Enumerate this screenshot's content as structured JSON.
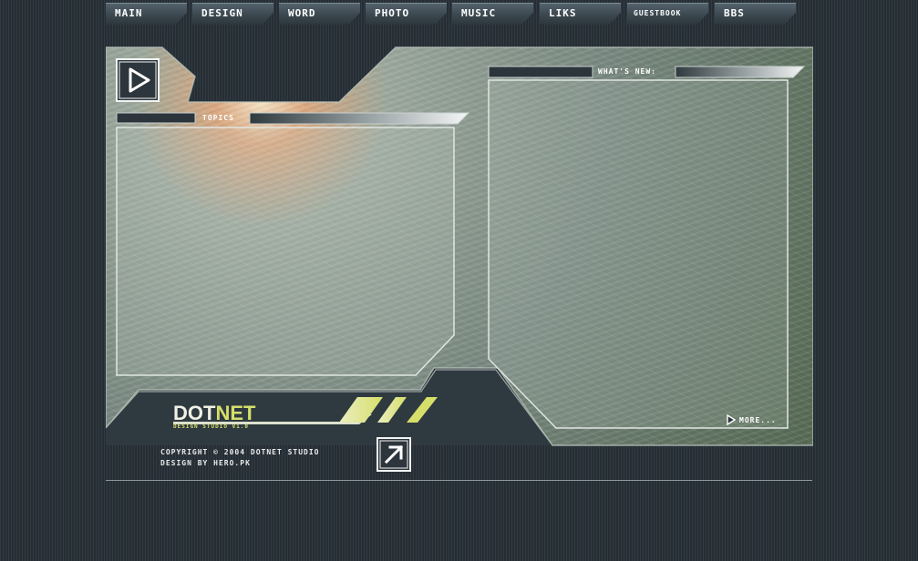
{
  "nav": {
    "tabs": [
      {
        "label": "main"
      },
      {
        "label": "design"
      },
      {
        "label": "word"
      },
      {
        "label": "photo"
      },
      {
        "label": "music"
      },
      {
        "label": "liks"
      },
      {
        "label": "guestbook"
      },
      {
        "label": "bbs"
      }
    ]
  },
  "sections": {
    "topics_label": "TOPICS",
    "whats_new_label": "WHAT'S NEW:",
    "more_label": "MORE..."
  },
  "brand": {
    "name_part1": "DOT",
    "name_part2": "NET",
    "tagline": "DESIGN STUDIO V1.0"
  },
  "footer": {
    "copyright_line": "COPYRIGHT © 2004 DOTNET STUDIO",
    "credit_line": "DESIGN BY HERO.PK"
  },
  "icons": {
    "play": "play-icon",
    "external": "arrow-up-right-icon",
    "more": "triangle-right-icon"
  },
  "colors": {
    "background": "#2c353c",
    "accent": "#d6df6a",
    "frame": "#8a9a8f"
  }
}
